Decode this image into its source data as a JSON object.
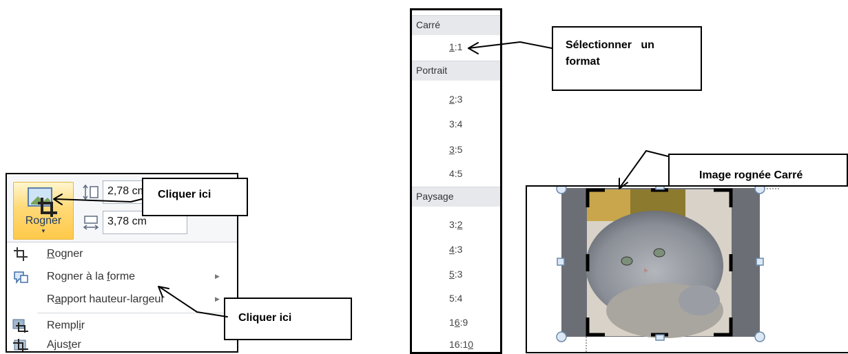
{
  "ribbon": {
    "crop_button_label": "Rogner",
    "height_value": "2,78 cm",
    "width_value": "3,78 cm"
  },
  "crop_menu": {
    "items": [
      {
        "label_u": "R",
        "label_rest": "ogner",
        "icon": "crop-icon",
        "submenu": false
      },
      {
        "label_pre": "Rogner à la ",
        "label_u": "f",
        "label_rest": "orme",
        "icon": "crop-to-shape-icon",
        "submenu": true
      },
      {
        "label_pre": "R",
        "label_u": "a",
        "label_rest": "pport hauteur-largeur",
        "icon": "",
        "submenu": true
      },
      {
        "label_pre": "Rempl",
        "label_u": "i",
        "label_rest": "r",
        "icon": "fill-icon",
        "submenu": false
      },
      {
        "label_pre": "Ajus",
        "label_u": "t",
        "label_rest": "er",
        "icon": "fit-icon",
        "submenu": false
      }
    ]
  },
  "callouts": {
    "click_here_1": "Cliquer ici",
    "click_here_2": "Cliquer ici",
    "select_format": "Sélectionner   un format",
    "cropped_image": "Image rognée Carré"
  },
  "ratios": {
    "groups": [
      {
        "title": "Carré",
        "items": [
          {
            "pre": "",
            "u": "1",
            "post": ":1"
          }
        ]
      },
      {
        "title": "Portrait",
        "items": [
          {
            "pre": "",
            "u": "2",
            "post": ":3"
          },
          {
            "pre": "3:4",
            "u": "",
            "post": ""
          },
          {
            "pre": "",
            "u": "3",
            "post": ":5"
          },
          {
            "pre": "4:5",
            "u": "",
            "post": ""
          }
        ]
      },
      {
        "title": "Paysage",
        "items": [
          {
            "pre": "3:",
            "u": "2",
            "post": ""
          },
          {
            "pre": "",
            "u": "4",
            "post": ":3"
          },
          {
            "pre": "",
            "u": "5",
            "post": ":3"
          },
          {
            "pre": "5:4",
            "u": "",
            "post": ""
          },
          {
            "pre": "1",
            "u": "6",
            "post": ":9"
          },
          {
            "pre": "16:1",
            "u": "0",
            "post": ""
          }
        ]
      }
    ]
  },
  "colors": {
    "crop_button_bg": "#ffd977",
    "ribbon_bg": "#f6f7f9",
    "header_bg": "#e6e8ec"
  }
}
